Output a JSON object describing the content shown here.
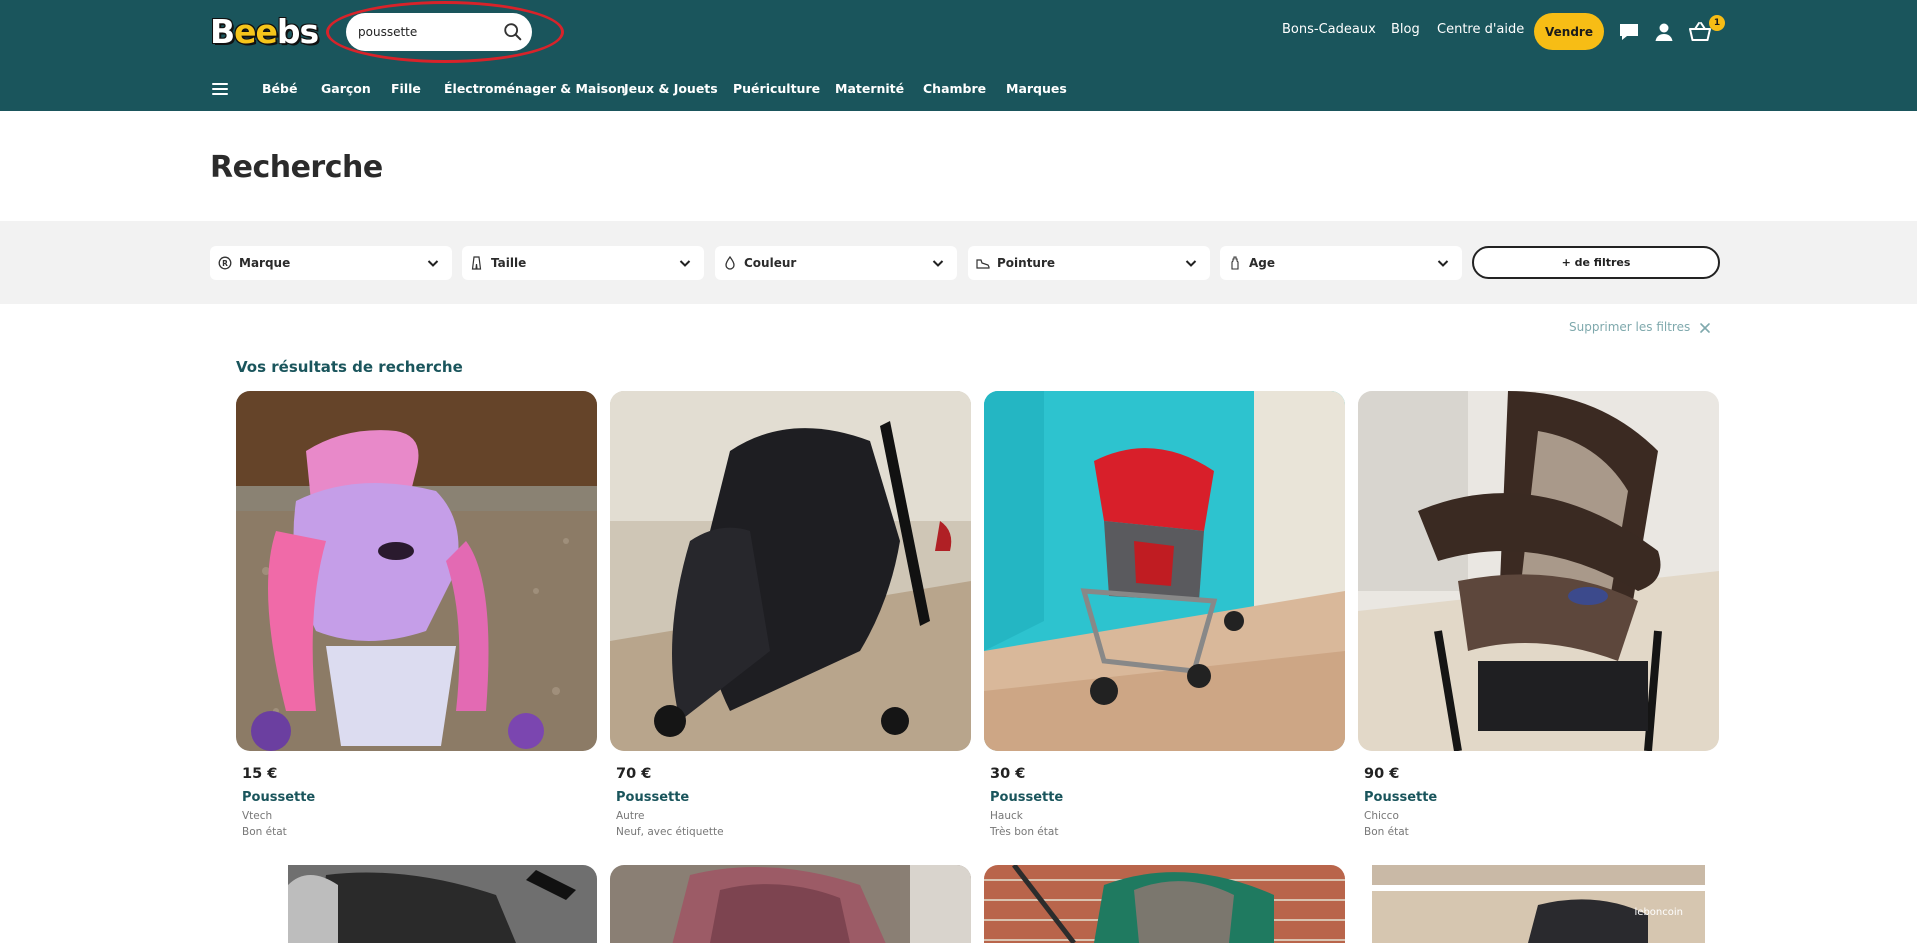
{
  "header": {
    "logo_text_b": "B",
    "logo_text_ee": "ee",
    "logo_text_bs": "bs",
    "search": {
      "value": "poussette",
      "placeholder": "Rechercher"
    },
    "links": [
      "Bons-Cadeaux",
      "Blog",
      "Centre d'aide"
    ],
    "sell_label": "Vendre",
    "cart_count": "1",
    "icons": [
      "search-icon",
      "chat-icon",
      "account-icon",
      "basket-icon"
    ]
  },
  "nav": {
    "items": [
      "Bébé",
      "Garçon",
      "Fille",
      "Électroménager & Maison",
      "Jeux & Jouets",
      "Puériculture",
      "Maternité",
      "Chambre",
      "Marques"
    ]
  },
  "page": {
    "title": "Recherche"
  },
  "filters": {
    "items": [
      {
        "label": "Marque",
        "icon": "brand-icon"
      },
      {
        "label": "Taille",
        "icon": "size-icon"
      },
      {
        "label": "Couleur",
        "icon": "color-drop-icon"
      },
      {
        "label": "Pointure",
        "icon": "shoe-icon"
      },
      {
        "label": "Age",
        "icon": "baby-bottle-icon"
      }
    ],
    "more_label": "+ de filtres",
    "clear_label": "Supprimer les filtres"
  },
  "results": {
    "title": "Vos résultats de recherche",
    "products": [
      {
        "price": "15 €",
        "title": "Poussette",
        "brand": "Vtech",
        "condition": "Bon état"
      },
      {
        "price": "70 €",
        "title": "Poussette",
        "brand": "Autre",
        "condition": "Neuf, avec étiquette"
      },
      {
        "price": "30 €",
        "title": "Poussette",
        "brand": "Hauck",
        "condition": "Très bon état"
      },
      {
        "price": "90 €",
        "title": "Poussette",
        "brand": "Chicco",
        "condition": "Bon état"
      }
    ],
    "watermark": "leboncoin"
  },
  "colors": {
    "header_bg": "#1a555c",
    "accent_yellow": "#f7bd15",
    "annotation_red": "#d8232a",
    "filter_band": "#f2f2f2"
  }
}
